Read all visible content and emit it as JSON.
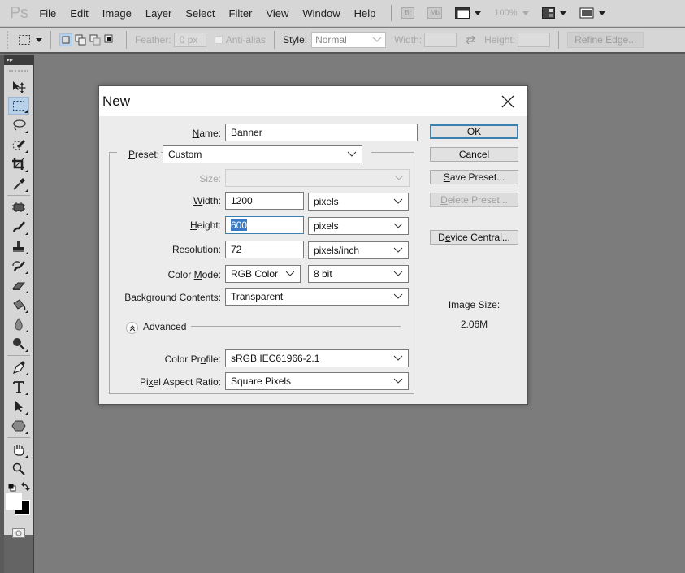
{
  "app": {
    "logo": "Ps",
    "menu": [
      "File",
      "Edit",
      "Image",
      "Layer",
      "Select",
      "Filter",
      "View",
      "Window",
      "Help"
    ],
    "appbar": {
      "bridge_label": "Br",
      "mini_bridge_label": "Mb",
      "zoom_level": "100%"
    }
  },
  "options_bar": {
    "feather_label": "Feather:",
    "feather_value": "0 px",
    "antialias_label": "Anti-alias",
    "style_label": "Style:",
    "style_value": "Normal",
    "width_label": "Width:",
    "width_value": "",
    "height_label": "Height:",
    "height_value": "",
    "refine_edge_label": "Refine Edge..."
  },
  "toolbox": {
    "collapse_label": "▸▸",
    "tools": [
      "move-tool",
      "rectangular-marquee-tool",
      "lasso-tool",
      "quick-selection-tool",
      "crop-tool",
      "eyedropper-tool",
      "spot-healing-brush-tool",
      "brush-tool",
      "clone-stamp-tool",
      "history-brush-tool",
      "eraser-tool",
      "paint-bucket-tool",
      "blur-tool",
      "dodge-tool",
      "pen-tool",
      "type-tool",
      "path-selection-tool",
      "shape-tool",
      "hand-tool",
      "zoom-tool"
    ],
    "active_tool": "rectangular-marquee-tool",
    "foreground_color": "#ffffff",
    "background_color": "#000000"
  },
  "dialog": {
    "title": "New",
    "name_label": "Name:",
    "name_value": "Banner",
    "preset_label": "Preset:",
    "preset_value": "Custom",
    "size_label": "Size:",
    "size_value": "",
    "width_label": "Width:",
    "width_value": "1200",
    "width_unit": "pixels",
    "height_label": "Height:",
    "height_value": "600",
    "height_unit": "pixels",
    "resolution_label": "Resolution:",
    "resolution_value": "72",
    "resolution_unit": "pixels/inch",
    "color_mode_label": "Color Mode:",
    "color_mode_value": "RGB Color",
    "bit_depth_value": "8 bit",
    "background_label": "Background Contents:",
    "background_value": "Transparent",
    "advanced_label": "Advanced",
    "color_profile_label": "Color Profile:",
    "color_profile_value": "sRGB IEC61966-2.1",
    "pixel_aspect_label": "Pixel Aspect Ratio:",
    "pixel_aspect_value": "Square Pixels",
    "buttons": {
      "ok": "OK",
      "cancel": "Cancel",
      "save_preset": "Save Preset...",
      "delete_preset": "Delete Preset...",
      "device_central": "Device Central..."
    },
    "image_size_label": "Image Size:",
    "image_size_value": "2.06M"
  },
  "colors": {
    "workspace": "#7c7c7c",
    "chrome": "#d6d6d6",
    "dialog_bg": "#ececec",
    "accent": "#3c7fb1",
    "selection_highlight": "#3a79c3"
  }
}
